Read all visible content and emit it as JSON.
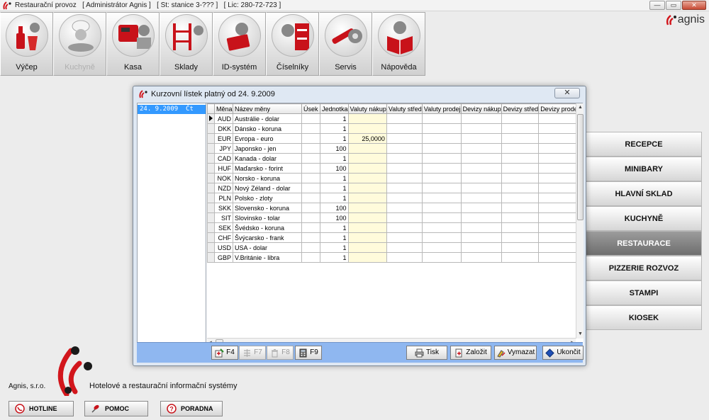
{
  "titlebar": {
    "app": "Restaurační provoz",
    "user": "[ Administrátor Agnis ]",
    "station": "[ St: stanice 3-??? ]",
    "license": "[ Lic: 280-72-723 ]",
    "minimize": "—",
    "maximize": "▭",
    "close": "✕"
  },
  "brand": {
    "logo_text": "agnis",
    "color": "#d2161c"
  },
  "toolbar": [
    {
      "label": "Výčep",
      "icon": "beer-bottle-icon",
      "state": "normal"
    },
    {
      "label": "Kuchyně",
      "icon": "chef-icon",
      "state": "disabled"
    },
    {
      "label": "Kasa",
      "icon": "cash-register-icon",
      "state": "normal"
    },
    {
      "label": "Sklady",
      "icon": "warehouse-shelf-icon",
      "state": "normal"
    },
    {
      "label": "ID-systém",
      "icon": "id-card-icon",
      "state": "normal"
    },
    {
      "label": "Číselníky",
      "icon": "catalog-cabinet-icon",
      "state": "normal"
    },
    {
      "label": "Servis",
      "icon": "wrench-gear-icon",
      "state": "normal"
    },
    {
      "label": "Nápověda",
      "icon": "help-book-icon",
      "state": "normal"
    }
  ],
  "side_buttons": [
    {
      "label": "RECEPCE",
      "active": false
    },
    {
      "label": "MINIBARY",
      "active": false
    },
    {
      "label": "HLAVNÍ SKLAD",
      "active": false
    },
    {
      "label": "KUCHYNĚ",
      "active": false
    },
    {
      "label": "RESTAURACE",
      "active": true
    },
    {
      "label": "PIZZERIE ROZVOZ",
      "active": false
    },
    {
      "label": "STAMPI",
      "active": false
    },
    {
      "label": "KIOSEK",
      "active": false
    }
  ],
  "dialog": {
    "title": "Kurzovní lístek platný od 24. 9.2009",
    "close": "✕",
    "dates": [
      "24. 9.2009  Čt"
    ],
    "columns": [
      "Měna",
      "Název měny",
      "Úsek",
      "Jednotka",
      "Valuty nákup",
      "Valuty střed",
      "Valuty prodej",
      "Devizy nákup",
      "Devizy střed",
      "Devizy prodej"
    ],
    "rows": [
      {
        "code": "AUD",
        "name": "Austrálie - dolar",
        "unit": "1",
        "valuty_nakup": "",
        "current": true
      },
      {
        "code": "DKK",
        "name": "Dánsko - koruna",
        "unit": "1",
        "valuty_nakup": ""
      },
      {
        "code": "EUR",
        "name": "Evropa - euro",
        "unit": "1",
        "valuty_nakup": "25,0000"
      },
      {
        "code": "JPY",
        "name": "Japonsko - jen",
        "unit": "100",
        "valuty_nakup": ""
      },
      {
        "code": "CAD",
        "name": "Kanada - dolar",
        "unit": "1",
        "valuty_nakup": ""
      },
      {
        "code": "HUF",
        "name": "Maďarsko - forint",
        "unit": "100",
        "valuty_nakup": ""
      },
      {
        "code": "NOK",
        "name": "Norsko - koruna",
        "unit": "1",
        "valuty_nakup": ""
      },
      {
        "code": "NZD",
        "name": "Nový Zéland - dolar",
        "unit": "1",
        "valuty_nakup": ""
      },
      {
        "code": "PLN",
        "name": "Polsko - zloty",
        "unit": "1",
        "valuty_nakup": ""
      },
      {
        "code": "SKK",
        "name": "Slovensko - koruna",
        "unit": "100",
        "valuty_nakup": ""
      },
      {
        "code": "SIT",
        "name": "Slovinsko - tolar",
        "unit": "100",
        "valuty_nakup": ""
      },
      {
        "code": "SEK",
        "name": "Švédsko - koruna",
        "unit": "1",
        "valuty_nakup": ""
      },
      {
        "code": "CHF",
        "name": "Švýcarsko - frank",
        "unit": "1",
        "valuty_nakup": ""
      },
      {
        "code": "USD",
        "name": "USA - dolar",
        "unit": "1",
        "valuty_nakup": ""
      },
      {
        "code": "GBP",
        "name": "V.Británie - libra",
        "unit": "1",
        "valuty_nakup": ""
      }
    ],
    "buttons": {
      "f4": "F4",
      "f7": "F7",
      "f8": "F8",
      "f9": "F9",
      "print": "Tisk",
      "create": "Založit",
      "delete": "Vymazat",
      "exit": "Ukončit"
    }
  },
  "footer": {
    "company": "Agnis, s.r.o.",
    "slogan": "Hotelové a restaurační informační systémy",
    "hotline": "HOTLINE",
    "help": "POMOC",
    "advice": "PORADNA"
  }
}
